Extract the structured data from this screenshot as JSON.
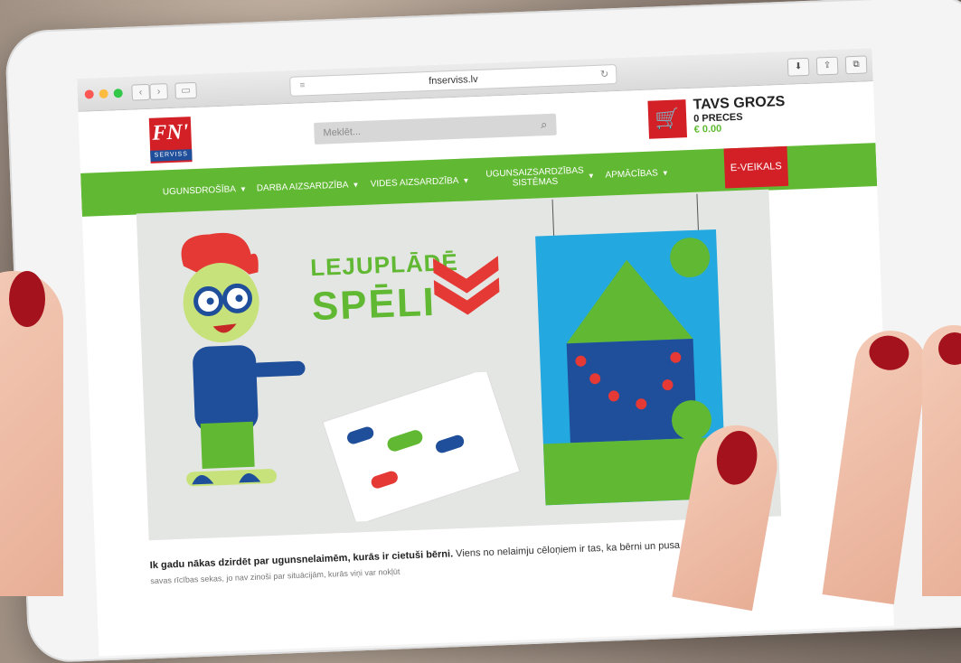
{
  "browser": {
    "url": "fnserviss.lv"
  },
  "header": {
    "logo_text": "FN'",
    "logo_sub": "SERVISS",
    "search_placeholder": "Meklēt...",
    "cart_title": "TAVS GROZS",
    "cart_items": "0 PRECES",
    "cart_total": "€ 0.00"
  },
  "nav": {
    "items": [
      {
        "label": "UGUNSDROŠĪBA"
      },
      {
        "label": "DARBA AIZSARDZĪBA"
      },
      {
        "label": "VIDES AIZSARDZĪBA"
      },
      {
        "label": "UGUNSAIZSARDZĪBAS SISTĒMAS"
      },
      {
        "label": "APMĀCĪBAS"
      }
    ],
    "shop_label": "E-VEIKALS"
  },
  "banner": {
    "heading1": "LEJUPLĀDĒ",
    "heading2": "SPĒLI"
  },
  "content": {
    "para_bold": "Ik gadu nākas dzirdēt par ugunsnelaimēm, kurās ir cietuši bērni.",
    "para_rest": " Viens no nelaimju cēloņiem ir tas, ka bērni un pusa",
    "para_line2": "savas rīcības sekas, jo nav zinoši par situācijām, kurās viņi var nokļūt"
  },
  "colors": {
    "brand_red": "#d32027",
    "brand_green": "#61b833",
    "brand_blue": "#1f4e9a"
  }
}
